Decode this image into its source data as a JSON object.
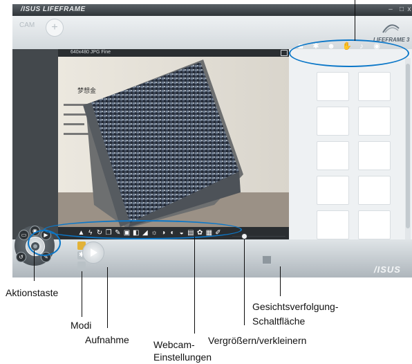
{
  "window": {
    "brand": "/ISUS LIFEFRAME",
    "minimize_label": "–",
    "close_label": "x"
  },
  "header": {
    "mode_label": "CAM",
    "lifeframe_logo": "LIFEFRAME 3"
  },
  "viewer": {
    "resolution_label": "640x480 JPG Fine"
  },
  "webcam_toolbar_icons": [
    "person-icon",
    "bolt-icon",
    "refresh-icon",
    "copy-icon",
    "pen-icon",
    "frame-icon",
    "frame2-icon",
    "triangle-icon",
    "sun-icon",
    "contrast-icon",
    "hue-icon",
    "saturation-icon",
    "gamma-icon",
    "color-icon",
    "settings-icon",
    "wrench-icon"
  ],
  "right_toolbar_icons": [
    "camera-icon",
    "gear-icon",
    "face-icon",
    "hand-icon",
    "mic-icon",
    "eye-icon"
  ],
  "bottom_logo": "/ISUS",
  "colors": {
    "callout": "#0b77c8",
    "app_dark": "#2a2e31",
    "panel": "#eef1f3"
  },
  "annotations": {
    "action_button": "Aktionstaste",
    "modes": "Modi",
    "record": "Aufnahme",
    "webcam_settings_line1": "Webcam-",
    "webcam_settings_line2": "Einstellungen",
    "zoom": "Vergrößern/verkleinern",
    "face_tracking_line1": "Gesichtsverfolgung-",
    "face_tracking_line2": "Schaltfläche"
  }
}
